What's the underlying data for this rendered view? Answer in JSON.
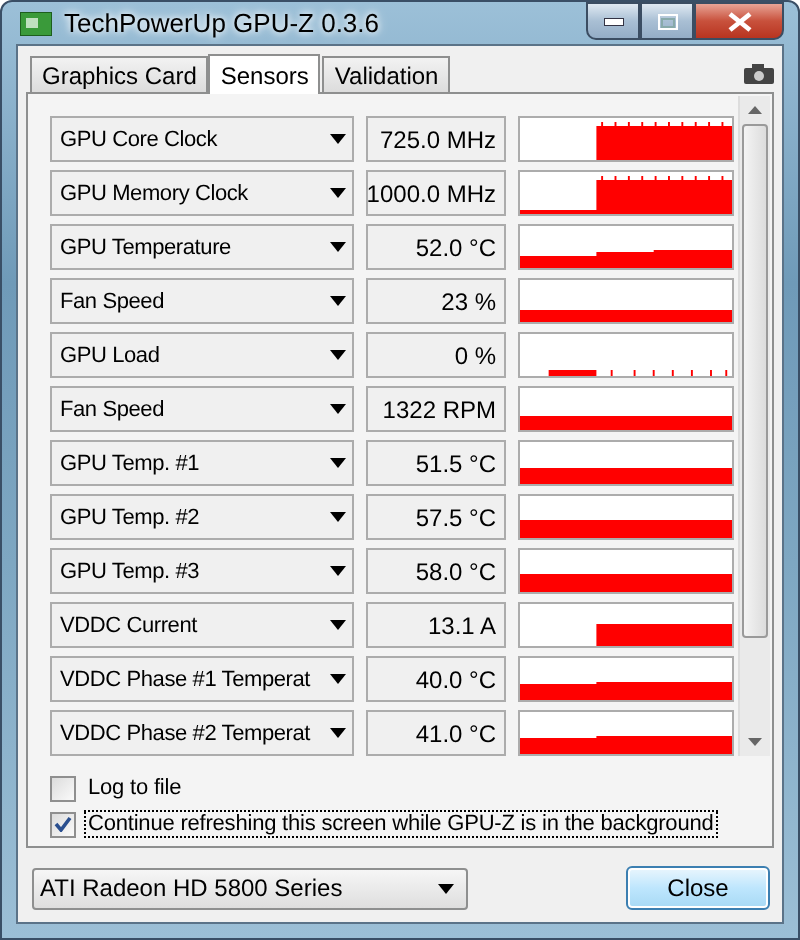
{
  "window": {
    "title": "TechPowerUp GPU-Z 0.3.6"
  },
  "tabs": [
    {
      "label": "Graphics Card",
      "selected": false
    },
    {
      "label": "Sensors",
      "selected": true
    },
    {
      "label": "Validation",
      "selected": false
    }
  ],
  "sensors": [
    {
      "name": "GPU Core Clock",
      "value": "725.0 MHz"
    },
    {
      "name": "GPU Memory Clock",
      "value": "1000.0 MHz"
    },
    {
      "name": "GPU Temperature",
      "value": "52.0 °C"
    },
    {
      "name": "Fan Speed",
      "value": "23 %"
    },
    {
      "name": "GPU Load",
      "value": "0 %"
    },
    {
      "name": "Fan Speed",
      "value": "1322 RPM"
    },
    {
      "name": "GPU Temp. #1",
      "value": "51.5 °C"
    },
    {
      "name": "GPU Temp. #2",
      "value": "57.5 °C"
    },
    {
      "name": "GPU Temp. #3",
      "value": "58.0 °C"
    },
    {
      "name": "VDDC Current",
      "value": "13.1 A"
    },
    {
      "name": "VDDC Phase #1 Temperat",
      "value": "40.0 °C"
    },
    {
      "name": "VDDC Phase #2 Temperat",
      "value": "41.0 °C"
    }
  ],
  "options": [
    {
      "label": "Log to file",
      "checked": false,
      "focused": false
    },
    {
      "label": "Continue refreshing this screen while GPU-Z is in the background",
      "checked": true,
      "focused": true
    }
  ],
  "gpu_select": {
    "value": "ATI Radeon HD 5800 Series"
  },
  "buttons": [
    {
      "label": "Close"
    }
  ]
}
